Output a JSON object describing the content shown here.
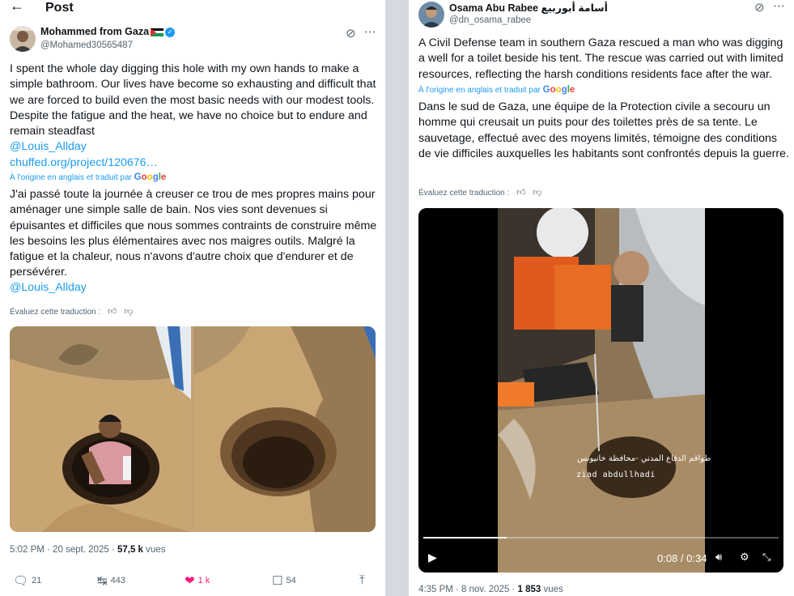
{
  "left_post": {
    "header": {
      "back_icon": "back-arrow-icon",
      "title": "Post"
    },
    "author": {
      "name": "Mohammed from Gaza",
      "handle": "@Mohamed30565487",
      "verified": true,
      "flag_icon": "palestine-flag-icon"
    },
    "original_text": "I spent the whole day digging this hole with my own hands to make a simple bathroom. Our lives have become so exhausting and difficult that we are forced to build even the most basic needs with our modest tools. Despite the fatigue and the heat, we have no choice but to endure and remain steadfast",
    "mention": "@Louis_Allday",
    "link": "chuffed.org/project/120676…",
    "translation_note": "À l'origine en anglais et traduit par",
    "translation_provider": "Google",
    "translated_text": "J'ai passé toute la journée à creuser ce trou de mes propres mains pour aménager une simple salle de bain. Nos vies sont devenues si épuisantes et difficiles que nous sommes contraints de construire même les besoins les plus élémentaires avec nos maigres outils. Malgré la fatigue et la chaleur, nous n'avons d'autre choix que d'endurer et de persévérer.",
    "translated_mention": "@Louis_Allday",
    "rate_translation": "Évaluez cette traduction :",
    "timestamp": "5:02 PM · 20 sept. 2025 · ",
    "views_count": "57,5 k",
    "views_label": " vues",
    "actions": {
      "replies": "21",
      "reposts": "443",
      "likes": "1 k",
      "bookmarks": "54"
    },
    "colors": {
      "like": "#f91880",
      "link": "#1d9bf0"
    }
  },
  "right_post": {
    "author": {
      "name": "Osama Abu Rabee أسامة أبوربيع",
      "handle": "@dn_osama_rabee"
    },
    "original_text": "A Civil Defense team in southern Gaza rescued a man who was digging a well for a toilet beside his tent. The rescue was carried out with limited resources, reflecting the harsh conditions residents face after the war.",
    "translation_note": "À l'origine en anglais et traduit par",
    "translation_provider": "Google",
    "translated_text": "Dans le sud de Gaza, une équipe de la Protection civile a secouru un homme qui creusait un puits pour des toilettes près de sa tente. Le sauvetage, effectué avec des moyens limités, témoigne des conditions de vie difficiles auxquelles les habitants sont confrontés depuis la guerre.",
    "rate_translation": "Évaluez cette traduction :",
    "video": {
      "caption_arabic": "طواقم الدفاع المدني -محافظة خانيونس",
      "caption_credit": "ziad abdullhadi",
      "time": "0:08 / 0:34",
      "progress": 0.235
    },
    "timestamp": "4:35 PM · 8 nov. 2025 · ",
    "views_count": "1 853",
    "views_label": " vues"
  }
}
